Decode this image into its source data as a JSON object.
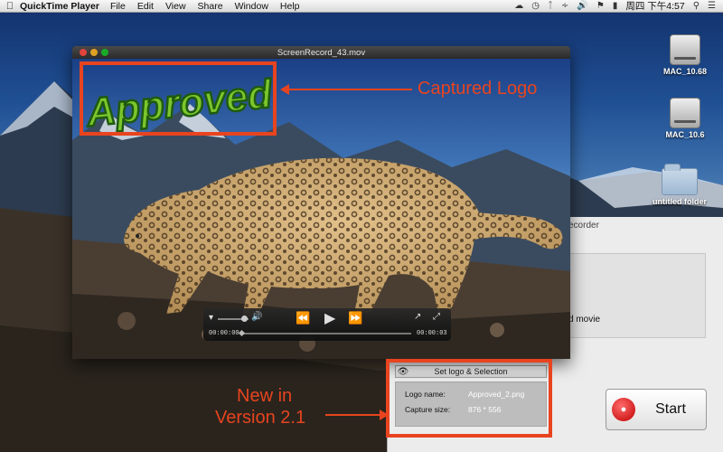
{
  "menubar": {
    "app_name": "QuickTime Player",
    "menus": [
      "File",
      "Edit",
      "View",
      "Share",
      "Window",
      "Help"
    ],
    "datetime": "周四 下午4:57"
  },
  "desktop": {
    "icons": [
      {
        "label": "MAC_10.68",
        "kind": "hard-drive-icon"
      },
      {
        "label": "MAC_10.6",
        "kind": "hard-drive-icon"
      },
      {
        "label": "untitled folder",
        "kind": "folder-icon"
      }
    ]
  },
  "video_window": {
    "title": "ScreenRecord_43.mov",
    "logo_text": "Approved",
    "controller": {
      "elapsed": "00:00:00",
      "remaining": "00:00:03"
    }
  },
  "recorder": {
    "title_fragment": "ecorder",
    "panel_text_fragment": "d movie",
    "logo_panel": {
      "header": "Set logo & Selection",
      "logo_name_label": "Logo name:",
      "logo_name_value": "Approved_2.png",
      "capture_size_label": "Capture size:",
      "capture_size_value": "876 * 556"
    },
    "start_label": "Start"
  },
  "annotations": {
    "captured_logo": "Captured Logo",
    "new_in_line1": "New in",
    "new_in_line2": "Version 2.1"
  },
  "colors": {
    "annotation": "#e8441f",
    "logo_green": "#7bc62d",
    "record_red": "#d40000"
  }
}
